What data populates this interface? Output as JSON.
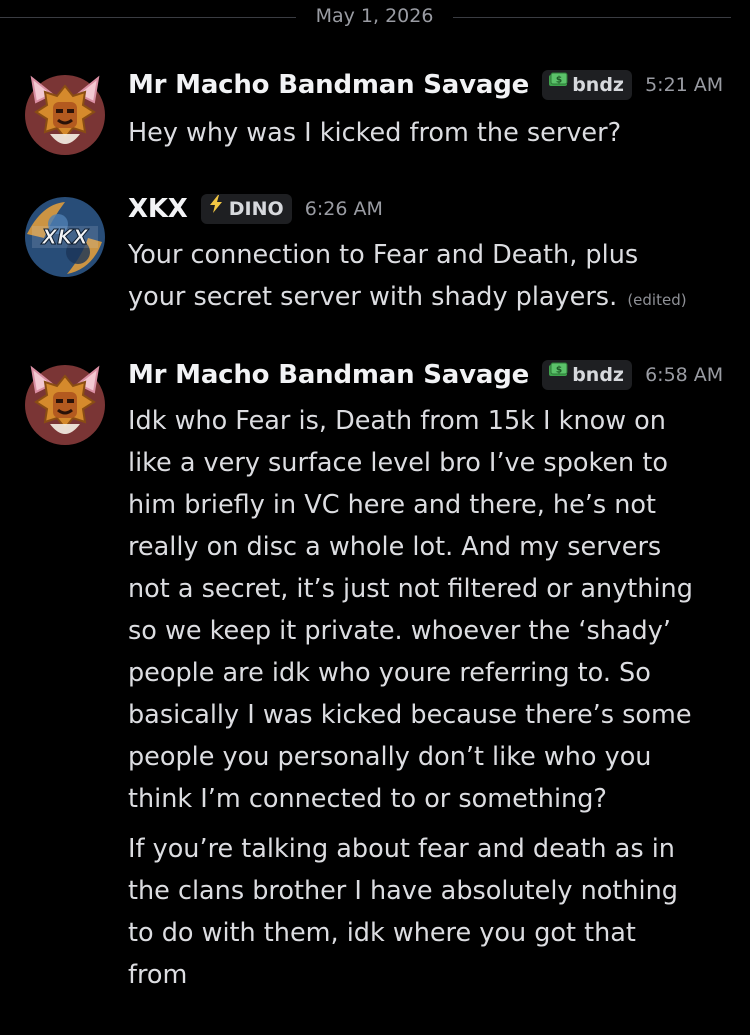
{
  "date_divider": "May 1, 2026",
  "messages": [
    {
      "username": "Mr Macho Bandman Savage",
      "tag": "bndz",
      "tag_icon": "money-icon",
      "timestamp": "5:21 AM",
      "lines": [
        "Hey why was I kicked from the server?"
      ]
    },
    {
      "username": "XKX",
      "tag": "DINO",
      "tag_icon": "lightning-icon",
      "timestamp": "6:26 AM",
      "avatar_text": "XKX",
      "lines": [
        "Your connection to Fear and Death, plus\nyour secret server with shady players."
      ],
      "edited_label": "(edited)"
    },
    {
      "username": "Mr Macho Bandman Savage",
      "tag": "bndz",
      "tag_icon": "money-icon",
      "timestamp": "6:58 AM",
      "lines": [
        "Idk who Fear is, Death from 15k I know on\nlike a very surface level bro I’ve spoken to\nhim briefly in VC here and there, he’s not\nreally on disc a whole lot.  And my servers\nnot a secret, it’s just not filtered or anything\nso we keep it private.  whoever the ‘shady’\npeople are idk who youre referring to.  So\nbasically I was kicked because there’s some\npeople you personally don’t like who you\nthink I’m connected to or something?",
        "If you’re talking about fear and death as in\nthe clans brother I have absolutely nothing\nto do with them, idk where you got that\nfrom"
      ]
    }
  ],
  "colors": {
    "background": "#000000",
    "username": "#f2f3f5",
    "text": "#dcdde1",
    "muted": "#9a9ca3",
    "tag_bg": "#1e1f22"
  }
}
